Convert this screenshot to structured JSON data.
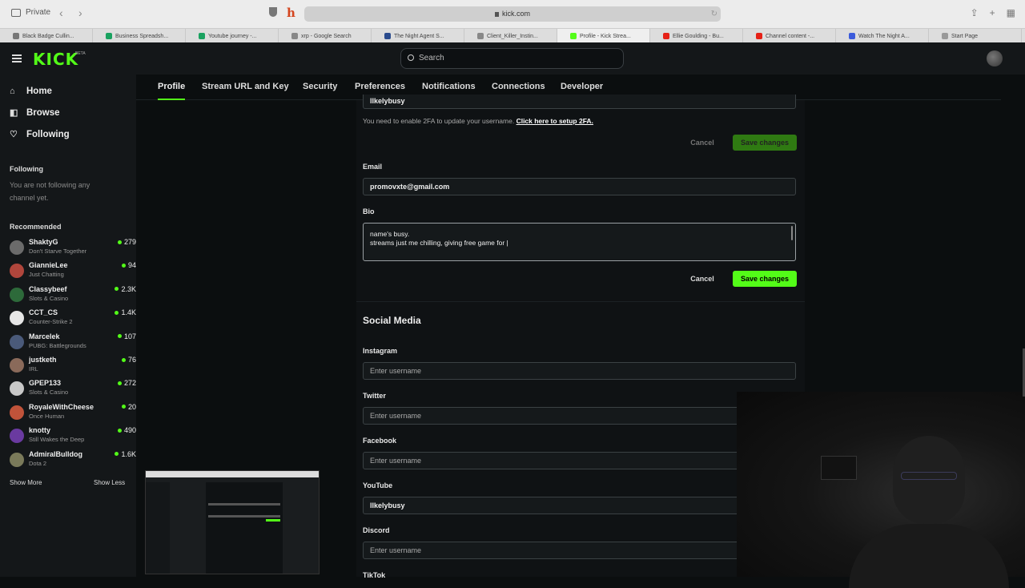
{
  "browser": {
    "private_label": "Private",
    "url": "kick.com",
    "tabs": [
      {
        "label": "Black Badge Cullin...",
        "color": "#777777"
      },
      {
        "label": "Business Spreadsh...",
        "color": "#1aa260"
      },
      {
        "label": "Youtube journey -...",
        "color": "#1aa260"
      },
      {
        "label": "xrp - Google Search",
        "color": "#888888"
      },
      {
        "label": "The Night Agent S...",
        "color": "#2a4b8d"
      },
      {
        "label": "Client_Killer_Instin...",
        "color": "#888888"
      },
      {
        "label": "Profile - Kick Strea...",
        "color": "#53fc18"
      },
      {
        "label": "Ellie Goulding - Bu...",
        "color": "#e62117"
      },
      {
        "label": "Channel content -...",
        "color": "#e62117"
      },
      {
        "label": "Watch The Night A...",
        "color": "#3b5bdb"
      },
      {
        "label": "Start Page",
        "color": "#999999"
      }
    ]
  },
  "header": {
    "logo": "KICK",
    "beta": "BETA",
    "search_placeholder": "Search"
  },
  "leftnav": {
    "items": [
      {
        "label": "Home",
        "icon": "home-icon"
      },
      {
        "label": "Browse",
        "icon": "browse-icon"
      },
      {
        "label": "Following",
        "icon": "heart-icon"
      }
    ],
    "following_title": "Following",
    "following_empty": "You are not following any channel yet.",
    "recommended_title": "Recommended",
    "recommended": [
      {
        "name": "ShaktyG",
        "game": "Don't Starve Together",
        "count": "279",
        "color": "#6b6b6b"
      },
      {
        "name": "GiannieLee",
        "game": "Just Chatting",
        "count": "94",
        "color": "#b0463c"
      },
      {
        "name": "Classybeef",
        "game": "Slots & Casino",
        "count": "2.3K",
        "color": "#2d6a3a"
      },
      {
        "name": "CCT_CS",
        "game": "Counter-Strike 2",
        "count": "1.4K",
        "color": "#e6e6e6"
      },
      {
        "name": "Marcelek",
        "game": "PUBG: Battlegrounds",
        "count": "107",
        "color": "#4a5a7a"
      },
      {
        "name": "justketh",
        "game": "IRL",
        "count": "76",
        "color": "#8a6a5a"
      },
      {
        "name": "GPEP133",
        "game": "Slots & Casino",
        "count": "272",
        "color": "#c8c8c8"
      },
      {
        "name": "RoyaleWithCheese",
        "game": "Once Human",
        "count": "20",
        "color": "#c0533a"
      },
      {
        "name": "knotty",
        "game": "Still Wakes the Deep",
        "count": "490",
        "color": "#6a3aa0"
      },
      {
        "name": "AdmiralBulldog",
        "game": "Dota 2",
        "count": "1.6K",
        "color": "#7a7a5a"
      }
    ],
    "show_more": "Show More",
    "show_less": "Show Less"
  },
  "subnav": {
    "tabs": [
      "Profile",
      "Stream URL and Key",
      "Security",
      "Preferences",
      "Notifications",
      "Connections",
      "Developer"
    ]
  },
  "form": {
    "username_value": "llkelybusy",
    "hint_text": "You need to enable 2FA to update your username. ",
    "hint_link": "Click here to setup 2FA.",
    "cancel_label": "Cancel",
    "save_label": "Save changes",
    "email_label": "Email",
    "email_value": "promovxte@gmail.com",
    "bio_label": "Bio",
    "bio_line1": "name's busy.",
    "bio_line2": "streams just me chilling, giving free game for |",
    "social_title": "Social Media",
    "social": [
      {
        "label": "Instagram",
        "value": "",
        "placeholder": "Enter username"
      },
      {
        "label": "Twitter",
        "value": "",
        "placeholder": "Enter username"
      },
      {
        "label": "Facebook",
        "value": "",
        "placeholder": "Enter username"
      },
      {
        "label": "YouTube",
        "value": "llkelybusy",
        "placeholder": ""
      },
      {
        "label": "Discord",
        "value": "",
        "placeholder": "Enter username"
      },
      {
        "label": "TikTok",
        "value": "",
        "placeholder": ""
      }
    ]
  }
}
